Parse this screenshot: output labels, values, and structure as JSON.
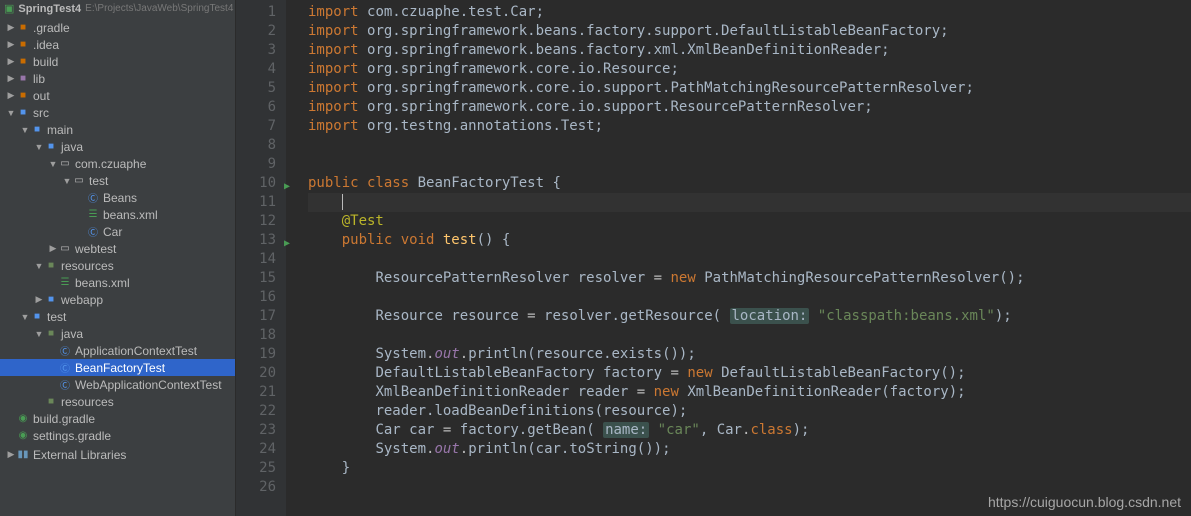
{
  "project": {
    "name": "SpringTest4",
    "path": "E:\\Projects\\JavaWeb\\SpringTest4"
  },
  "tree": [
    {
      "depth": 0,
      "arrow": "▶",
      "icon": "folder-o",
      "label": ".gradle"
    },
    {
      "depth": 0,
      "arrow": "▶",
      "icon": "folder-o",
      "label": ".idea"
    },
    {
      "depth": 0,
      "arrow": "▶",
      "icon": "folder-o",
      "label": "build"
    },
    {
      "depth": 0,
      "arrow": "▶",
      "icon": "folder-t",
      "label": "lib"
    },
    {
      "depth": 0,
      "arrow": "▶",
      "icon": "folder-o",
      "label": "out"
    },
    {
      "depth": 0,
      "arrow": "▼",
      "icon": "folder-blue",
      "label": "src"
    },
    {
      "depth": 1,
      "arrow": "▼",
      "icon": "folder-blue",
      "label": "main"
    },
    {
      "depth": 2,
      "arrow": "▼",
      "icon": "folder-blue",
      "label": "java"
    },
    {
      "depth": 3,
      "arrow": "▼",
      "icon": "pkg",
      "label": "com.czuaphe"
    },
    {
      "depth": 4,
      "arrow": "▼",
      "icon": "pkg",
      "label": "test"
    },
    {
      "depth": 5,
      "arrow": "",
      "icon": "file-java",
      "label": "Beans"
    },
    {
      "depth": 5,
      "arrow": "",
      "icon": "file-xml",
      "label": "beans.xml"
    },
    {
      "depth": 5,
      "arrow": "",
      "icon": "file-java",
      "label": "Car"
    },
    {
      "depth": 3,
      "arrow": "▶",
      "icon": "pkg",
      "label": "webtest"
    },
    {
      "depth": 2,
      "arrow": "▼",
      "icon": "folder-b",
      "label": "resources"
    },
    {
      "depth": 3,
      "arrow": "",
      "icon": "file-xml",
      "label": "beans.xml"
    },
    {
      "depth": 2,
      "arrow": "▶",
      "icon": "folder-blue",
      "label": "webapp"
    },
    {
      "depth": 1,
      "arrow": "▼",
      "icon": "folder-blue",
      "label": "test"
    },
    {
      "depth": 2,
      "arrow": "▼",
      "icon": "folder-b",
      "label": "java"
    },
    {
      "depth": 3,
      "arrow": "",
      "icon": "file-java",
      "label": "ApplicationContextTest"
    },
    {
      "depth": 3,
      "arrow": "",
      "icon": "file-java",
      "label": "BeanFactoryTest",
      "selected": true
    },
    {
      "depth": 3,
      "arrow": "",
      "icon": "file-java",
      "label": "WebApplicationContextTest"
    },
    {
      "depth": 2,
      "arrow": "",
      "icon": "folder-b",
      "label": "resources"
    },
    {
      "depth": 0,
      "arrow": "",
      "icon": "gradle",
      "label": "build.gradle"
    },
    {
      "depth": 0,
      "arrow": "",
      "icon": "gradle",
      "label": "settings.gradle"
    }
  ],
  "external_lib": "External Libraries",
  "code": [
    {
      "n": 1,
      "html": "<span class='kw'>import</span> <span class='id'>com.czuaphe.test.Car;</span>"
    },
    {
      "n": 2,
      "html": "<span class='kw'>import</span> <span class='id'>org.springframework.beans.factory.support.DefaultListableBeanFactory;</span>"
    },
    {
      "n": 3,
      "html": "<span class='kw'>import</span> <span class='id'>org.springframework.beans.factory.xml.XmlBeanDefinitionReader;</span>"
    },
    {
      "n": 4,
      "html": "<span class='kw'>import</span> <span class='id'>org.springframework.core.io.Resource;</span>"
    },
    {
      "n": 5,
      "html": "<span class='kw'>import</span> <span class='id'>org.springframework.core.io.support.PathMatchingResourcePatternResolver;</span>"
    },
    {
      "n": 6,
      "html": "<span class='kw'>import</span> <span class='id'>org.springframework.core.io.support.ResourcePatternResolver;</span>"
    },
    {
      "n": 7,
      "html": "<span class='kw'>import</span> <span class='id'>org.testng.annotations.Test;</span>"
    },
    {
      "n": 8,
      "html": ""
    },
    {
      "n": 9,
      "html": ""
    },
    {
      "n": 10,
      "html": "<span class='kw'>public class</span> <span class='type'>BeanFactoryTest</span> <span class='pn'>{</span>",
      "run": true
    },
    {
      "n": 11,
      "html": "    <span class='caret'></span>",
      "cursor": true
    },
    {
      "n": 12,
      "html": "    <span class='ann'>@Test</span>"
    },
    {
      "n": 13,
      "html": "    <span class='kw'>public void</span> <span class='nm'>test</span><span class='pn'>() {</span>",
      "run": true
    },
    {
      "n": 14,
      "html": ""
    },
    {
      "n": 15,
      "html": "        <span class='type'>ResourcePatternResolver</span> <span class='id'>resolver</span> = <span class='kw'>new</span> <span class='type'>PathMatchingResourcePatternResolver</span><span class='pn'>();</span>"
    },
    {
      "n": 16,
      "html": ""
    },
    {
      "n": 17,
      "html": "        <span class='type'>Resource</span> <span class='id'>resource</span> = <span class='id'>resolver.getResource</span><span class='pn'>(</span> <span class='cm-param'>location:</span> <span class='str'>\"classpath:beans.xml\"</span><span class='pn'>);</span>"
    },
    {
      "n": 18,
      "html": ""
    },
    {
      "n": 19,
      "html": "        <span class='type'>System</span>.<span class='st'>out</span>.<span class='id'>println</span><span class='pn'>(</span><span class='id'>resource.exists</span><span class='pn'>());</span>"
    },
    {
      "n": 20,
      "html": "        <span class='type'>DefaultListableBeanFactory</span> <span class='id'>factory</span> = <span class='kw'>new</span> <span class='type'>DefaultListableBeanFactory</span><span class='pn'>();</span>"
    },
    {
      "n": 21,
      "html": "        <span class='type'>XmlBeanDefinitionReader</span> <span class='id'>reader</span> = <span class='kw'>new</span> <span class='type'>XmlBeanDefinitionReader</span><span class='pn'>(</span><span class='id'>factory</span><span class='pn'>);</span>"
    },
    {
      "n": 22,
      "html": "        <span class='id'>reader.loadBeanDefinitions</span><span class='pn'>(</span><span class='id'>resource</span><span class='pn'>);</span>"
    },
    {
      "n": 23,
      "html": "        <span class='type'>Car</span> <span class='id'>car</span> = <span class='id'>factory.getBean</span><span class='pn'>(</span> <span class='cm-param'>name:</span> <span class='str'>\"car\"</span><span class='pn'>,</span> <span class='type'>Car</span>.<span class='kw'>class</span><span class='pn'>);</span>"
    },
    {
      "n": 24,
      "html": "        <span class='type'>System</span>.<span class='st'>out</span>.<span class='id'>println</span><span class='pn'>(</span><span class='id'>car.toString</span><span class='pn'>());</span>"
    },
    {
      "n": 25,
      "html": "    <span class='pn'>}</span>"
    },
    {
      "n": 26,
      "html": ""
    }
  ],
  "watermark": "https://cuiguocun.blog.csdn.net"
}
